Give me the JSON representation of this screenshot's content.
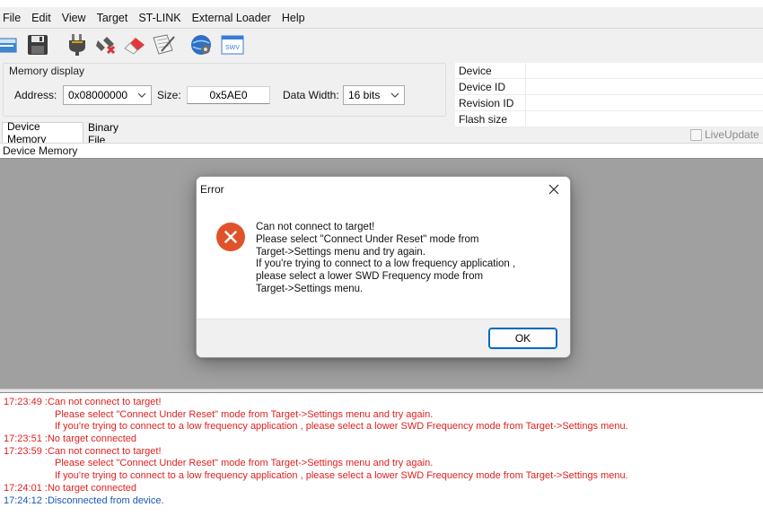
{
  "menu": [
    "File",
    "Edit",
    "View",
    "Target",
    "ST-LINK",
    "External Loader",
    "Help"
  ],
  "toolbar": {
    "icons": [
      "open-file-icon",
      "save-icon",
      "connect-icon",
      "disconnect-icon",
      "erase-icon",
      "program-icon",
      "external-loader-icon",
      "swv-icon"
    ],
    "swv_label": "SWV"
  },
  "memory_display": {
    "title": "Memory display",
    "address_label": "Address:",
    "address_value": "0x08000000",
    "size_label": "Size:",
    "size_value": "0x5AE0",
    "data_width_label": "Data Width:",
    "data_width_value": "16 bits"
  },
  "device_info": {
    "rows": [
      "Device",
      "Device ID",
      "Revision ID",
      "Flash size"
    ]
  },
  "tabs": [
    "Device Memory",
    "Binary File"
  ],
  "live_update_label": "LiveUpdate",
  "device_memory_label": "Device Memory",
  "dialog": {
    "title": "Error",
    "message": [
      "Can not connect to target!",
      "Please select \"Connect Under Reset\" mode from",
      "Target->Settings menu and try again.",
      "If you're trying to connect to a low frequency application ,",
      "please select a lower SWD Frequency mode from",
      "Target->Settings menu."
    ],
    "ok_label": "OK"
  },
  "log": [
    {
      "time": "17:23:49 : ",
      "text": "Can not connect to target!",
      "color": "red"
    },
    {
      "time": "",
      "text": "Please select \"Connect Under Reset\" mode from Target->Settings menu and try again.",
      "color": "red"
    },
    {
      "time": "",
      "text": "If you're trying to connect to a low frequency application , please select a lower SWD Frequency mode from Target->Settings menu.",
      "color": "red"
    },
    {
      "time": "17:23:51 : ",
      "text": "No target connected",
      "color": "red"
    },
    {
      "time": "17:23:59 : ",
      "text": "Can not connect to target!",
      "color": "red"
    },
    {
      "time": "",
      "text": "Please select \"Connect Under Reset\" mode from Target->Settings menu and try again.",
      "color": "red"
    },
    {
      "time": "",
      "text": "If you're trying to connect to a low frequency application , please select a lower SWD Frequency mode from Target->Settings menu.",
      "color": "red"
    },
    {
      "time": "17:24:01 : ",
      "text": "No target connected",
      "color": "red"
    },
    {
      "time": "17:24:12 : ",
      "text": "Disconnected from device.",
      "color": "blue"
    }
  ],
  "colors": {
    "error_red": "#e02020",
    "info_blue": "#1a57b8",
    "error_icon": "#e0532a",
    "ok_border": "#0067c0"
  }
}
